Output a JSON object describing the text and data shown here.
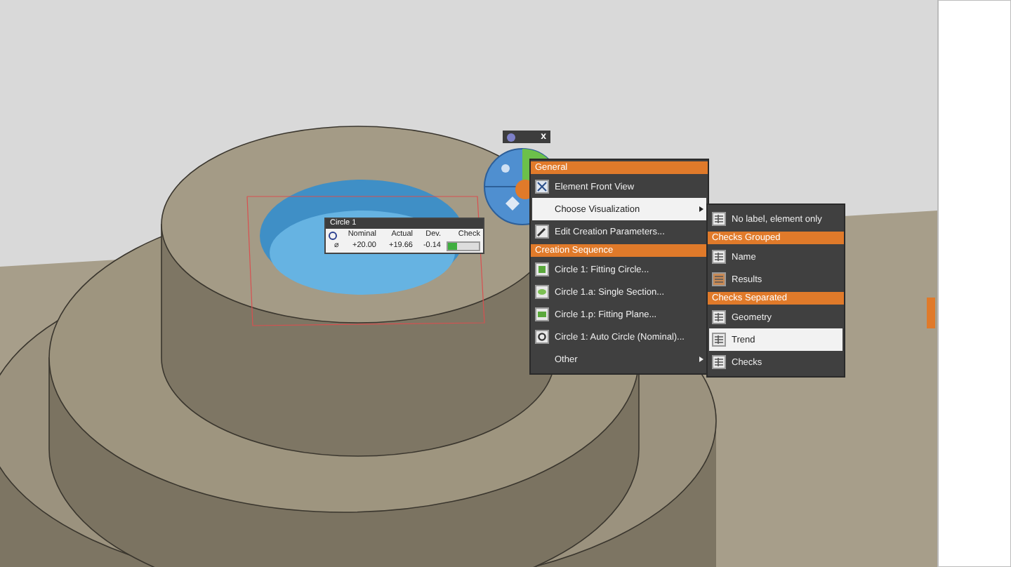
{
  "measurement_label": {
    "title": "Circle 1",
    "columns": [
      "Nominal",
      "Actual",
      "Dev.",
      "Check"
    ],
    "symbol": "⌀",
    "values": [
      "+20.00",
      "+19.66",
      "-0.14"
    ]
  },
  "mini_toolbar": {
    "close": "x"
  },
  "context_menu": {
    "sections": [
      {
        "heading": "General",
        "items": [
          {
            "label": "Element Front View",
            "kind": "front-view",
            "submenu": false,
            "selected": false
          },
          {
            "label": "Choose Visualization",
            "kind": "plain",
            "submenu": true,
            "selected": true
          },
          {
            "label": "Edit Creation Parameters...",
            "kind": "edit",
            "submenu": false,
            "selected": false
          }
        ]
      },
      {
        "heading": "Creation Sequence",
        "items": [
          {
            "label": "Circle 1: Fitting Circle...",
            "kind": "fit-circle",
            "submenu": false,
            "selected": false
          },
          {
            "label": "Circle 1.a: Single Section...",
            "kind": "section",
            "submenu": false,
            "selected": false
          },
          {
            "label": "Circle 1.p: Fitting Plane...",
            "kind": "fit-plane",
            "submenu": false,
            "selected": false
          },
          {
            "label": "Circle 1: Auto Circle (Nominal)...",
            "kind": "auto-circle",
            "submenu": false,
            "selected": false
          },
          {
            "label": "Other",
            "kind": "plain",
            "submenu": true,
            "selected": false
          }
        ]
      }
    ]
  },
  "submenu": {
    "sections": [
      {
        "items": [
          {
            "label": "No label, element only",
            "kind": "grid",
            "selected": false
          }
        ]
      },
      {
        "heading": "Checks Grouped",
        "items": [
          {
            "label": "Name",
            "kind": "grid",
            "selected": false
          },
          {
            "label": "Results",
            "kind": "results",
            "selected": false
          }
        ]
      },
      {
        "heading": "Checks Separated",
        "items": [
          {
            "label": "Geometry",
            "kind": "grid",
            "selected": false
          },
          {
            "label": "Trend",
            "kind": "grid",
            "selected": true
          },
          {
            "label": "Checks",
            "kind": "grid",
            "selected": false
          }
        ]
      }
    ]
  }
}
